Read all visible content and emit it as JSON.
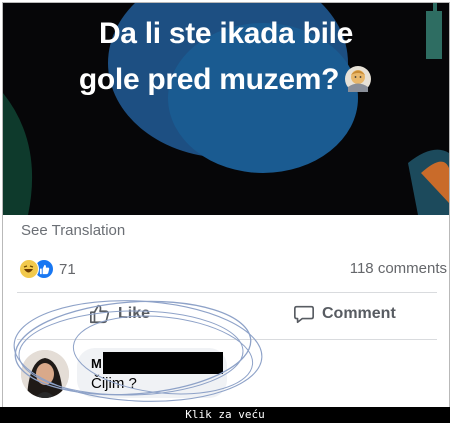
{
  "post": {
    "image_caption_line1": "Da li ste ikada bile",
    "image_caption_line2": "gole pred muzem?",
    "caption_emoji": "person-raising-hands-emoji",
    "see_translation": "See Translation",
    "reaction_count": "71",
    "reaction_icons": [
      "haha-reaction-icon",
      "like-reaction-icon"
    ],
    "comments_count": "118 comments"
  },
  "actions": {
    "like_label": "Like",
    "comment_label": "Comment"
  },
  "comment": {
    "author_initial": "M",
    "text": "Čijim ?"
  },
  "footer": {
    "text": "Klik za veću"
  },
  "colors": {
    "facebook_blue": "#1877f2",
    "haha_yellow": "#f2c94c",
    "ink_circle": "#8ea2c8"
  }
}
